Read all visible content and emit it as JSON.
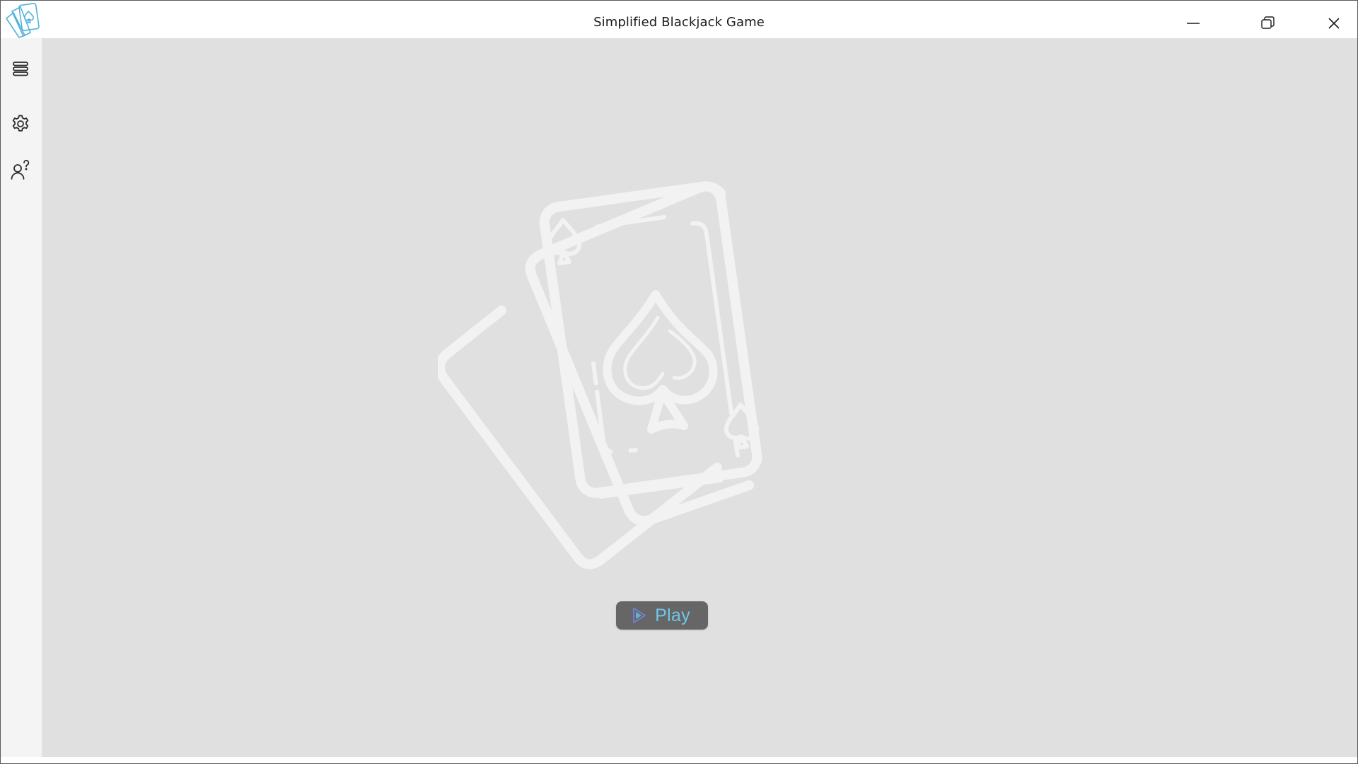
{
  "window": {
    "title": "Simplified Blackjack Game",
    "logo_icon": "playing-cards-logo-icon",
    "controls": {
      "minimize_icon": "minimize-icon",
      "restore_icon": "restore-icon",
      "close_icon": "close-icon"
    }
  },
  "sidebar": {
    "items": [
      {
        "icon": "menu-lines-icon",
        "name": "menu"
      },
      {
        "icon": "gear-icon",
        "name": "settings"
      },
      {
        "icon": "user-help-icon",
        "name": "help"
      }
    ]
  },
  "main": {
    "illustration_icon": "playing-cards-illustration",
    "play_button": {
      "label": "Play",
      "icon": "play-icon"
    }
  },
  "colors": {
    "accent": "#6ec8ea",
    "button_bg": "#666666",
    "content_bg": "#e0e0e0",
    "sidebar_bg": "#f4f4f4",
    "illustration": "#f2f2f2"
  }
}
